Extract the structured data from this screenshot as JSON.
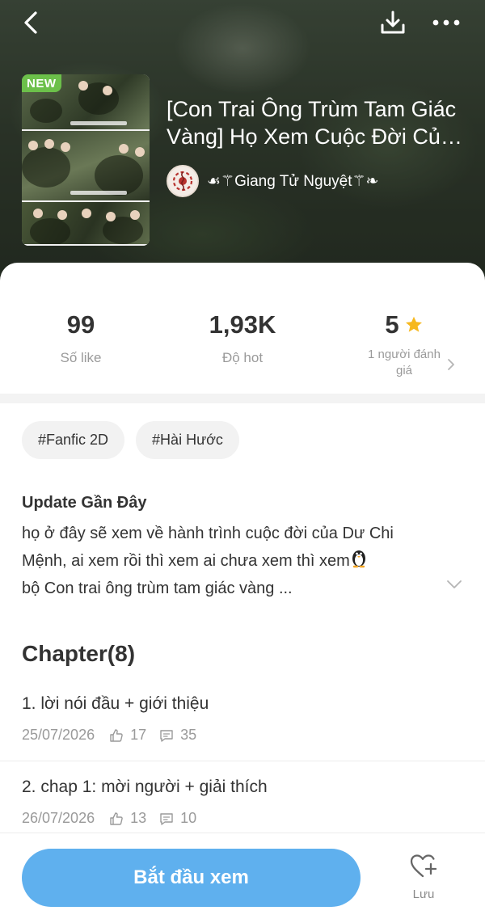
{
  "header": {
    "back_icon": "chevron-left-icon",
    "download_icon": "download-icon",
    "more_icon": "more-horizontal-icon"
  },
  "book": {
    "badge": "NEW",
    "title": "[Con Trai Ông Trùm Tam Giác Vàng] Họ Xem Cuộc Đời Của Dư Chi Mệnh",
    "author": "☙⚚Giang Tử Nguyệt⚚❧"
  },
  "stats": [
    {
      "value": "99",
      "label": "Số like"
    },
    {
      "value": "1,93K",
      "label": "Độ hot"
    },
    {
      "value": "5",
      "label": "1 người đánh giá",
      "icon": "star-icon"
    }
  ],
  "tags": [
    "#Fanfic 2D",
    "#Hài Hước"
  ],
  "update": {
    "title": "Update Gần Đây",
    "text_line1": "họ ở đây sẽ xem về hành trình cuộc đời của Dư Chi",
    "text_line2": "Mệnh, ai xem rồi thì xem ai chưa xem thì xem",
    "text_line3": "bộ Con trai ông trùm tam giác vàng ..."
  },
  "chapters_heading": "Chapter(8)",
  "chapters": [
    {
      "title": "1. lời nói đầu + giới thiệu",
      "date": "25/07/2026",
      "likes": "17",
      "comments": "35"
    },
    {
      "title": "2. chap 1: mời người + giải thích",
      "date": "26/07/2026",
      "likes": "13",
      "comments": "10"
    }
  ],
  "actions": {
    "start_label": "Bắt đầu xem",
    "save_label": "Lưu",
    "save_icon": "heart-plus-icon"
  },
  "colors": {
    "accent": "#5fb0ee",
    "badge": "#6cc04a",
    "star": "#f6b81e",
    "muted_text": "#9a9a9a"
  }
}
